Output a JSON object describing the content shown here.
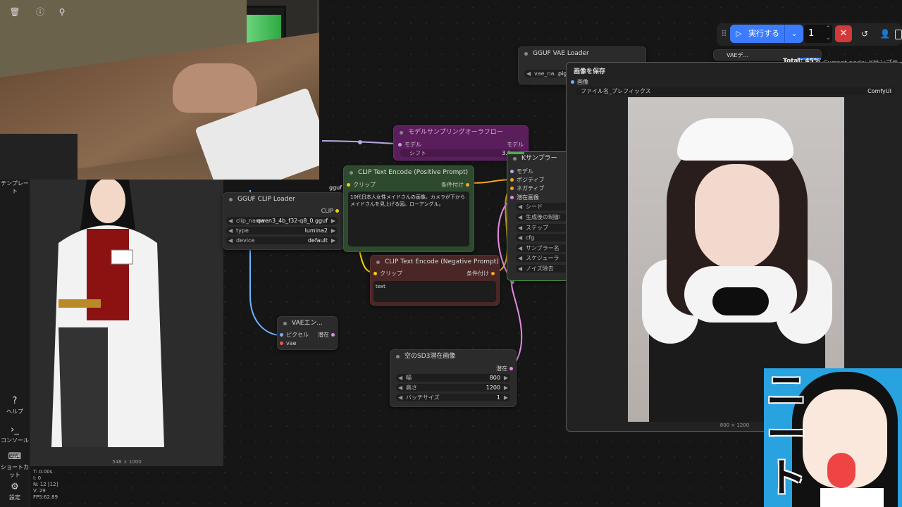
{
  "sidebar": {
    "template_label": "テンプレート",
    "help_label": "ヘルプ",
    "console_label": "コンソール",
    "shortcut_label": "ショートカット",
    "settings_label": "設定"
  },
  "toolbar": {
    "run_label": "実行する",
    "queue_count": "1",
    "progress_total": "Total: 45%",
    "current_node": "Current node: Kサンプラー"
  },
  "nodes": {
    "vae_loader": {
      "title": "GGUF VAE Loader",
      "widget_label": "vae_na...",
      "widget_value": "pig_f"
    },
    "vae_small": {
      "title": "VAEデ..."
    },
    "model_sampling": {
      "title": "モデルサンプリングオーラフロー",
      "in_label": "モデル",
      "out_label": "モデル",
      "shift_label": "シフト",
      "shift_value": "3.0"
    },
    "clip_loader": {
      "title": "GGUF CLIP Loader",
      "out_label": "CLIP",
      "gguf_tag": "gguf",
      "widgets": [
        {
          "label": "clip_name",
          "value": "qwen3_4b_f32-q8_0.gguf"
        },
        {
          "label": "type",
          "value": "lumina2"
        },
        {
          "label": "device",
          "value": "default"
        }
      ]
    },
    "pos_prompt": {
      "title": "CLIP Text Encode (Positive Prompt)",
      "in_label": "クリップ",
      "out_label": "条件付け",
      "text": "10代日本人女性メイドさんの画像。カメラが下からメイドさんを見上げる図。ローアングル。"
    },
    "neg_prompt": {
      "title": "CLIP Text Encode (Negative Prompt)",
      "in_label": "クリップ",
      "out_label": "条件付け",
      "text": "text"
    },
    "vae_encode": {
      "title": "VAEエン...",
      "in1": "ピクセル",
      "in2": "vae",
      "out": "潜在"
    },
    "latent": {
      "title": "空のSD3潜在画像",
      "out": "潜在",
      "widgets": [
        {
          "label": "幅",
          "value": "800"
        },
        {
          "label": "高さ",
          "value": "1200"
        },
        {
          "label": "バッチサイズ",
          "value": "1"
        }
      ]
    },
    "ksampler": {
      "title": "Kサンプラー",
      "inputs": [
        "モデル",
        "ポジティブ",
        "ネガティブ",
        "潜在画像"
      ],
      "widgets": [
        "シード",
        "生成後の制御",
        "ステップ",
        "cfg",
        "サンプラー名",
        "スケジューラ",
        "ノイズ除去"
      ]
    },
    "save_image": {
      "title": "画像を保存",
      "in_label": "画像",
      "prefix_label": "ファイル名_プレフィックス",
      "prefix_value": "ComfyUI",
      "size": "800 × 1200"
    },
    "left_preview": {
      "size": "548 × 1000"
    },
    "gguf_label": "gguf"
  },
  "stats": {
    "t": "T: 0.00s",
    "i": "I: 0",
    "n": "N: 12 [12]",
    "v": "V: 29",
    "fps": "FPS:62.89"
  },
  "overlay": {
    "neet_text": "ニート"
  }
}
